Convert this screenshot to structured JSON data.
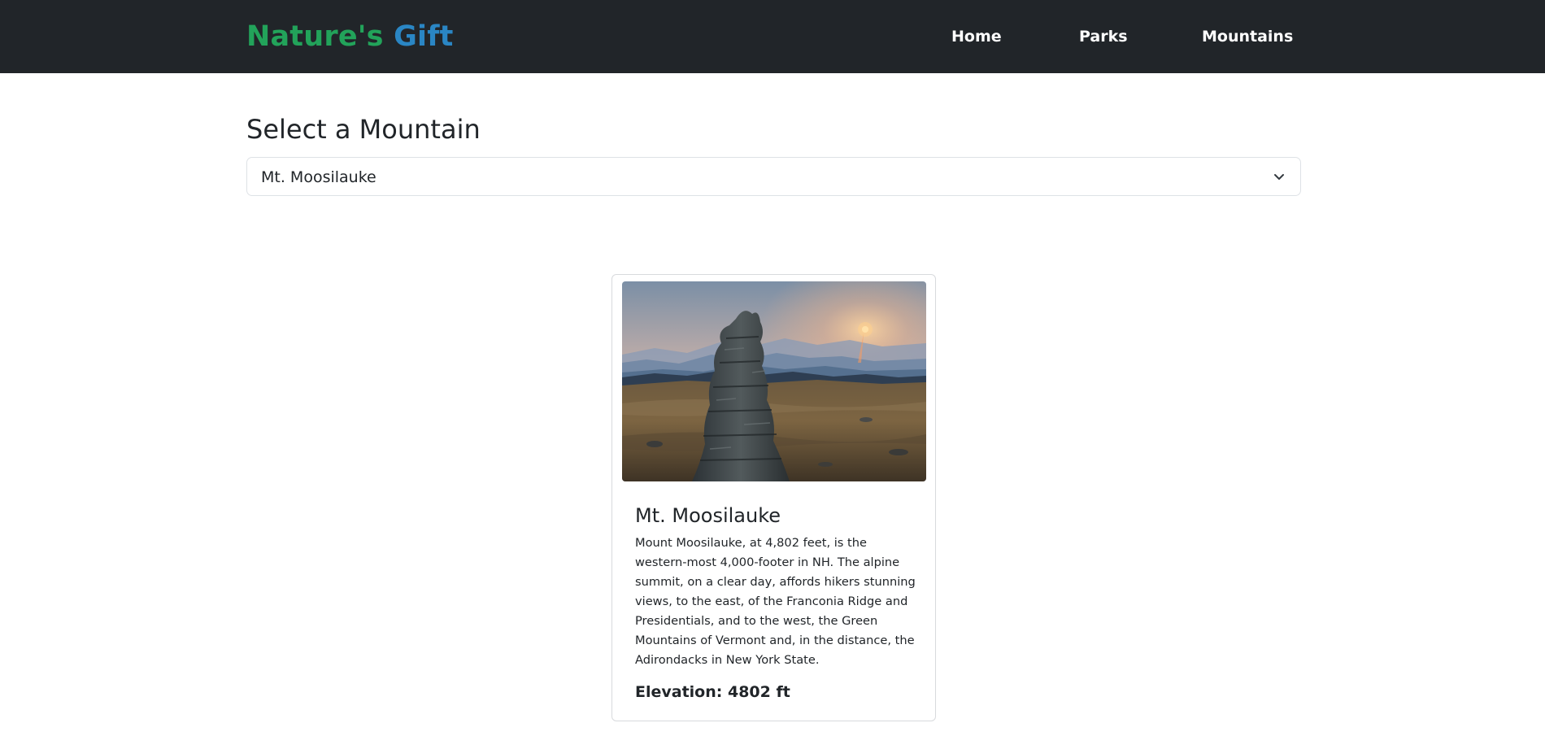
{
  "navbar": {
    "brand_part1": "Nature's",
    "brand_part2": "Gift",
    "links": [
      {
        "label": "Home"
      },
      {
        "label": "Parks"
      },
      {
        "label": "Mountains"
      }
    ]
  },
  "main": {
    "heading": "Select a Mountain",
    "select": {
      "selected_value": "Mt. Moosilauke"
    }
  },
  "card": {
    "image_alt": "Mt. Moosilauke",
    "title": "Mt. Moosilauke",
    "description": "Mount Moosilauke, at 4,802 feet, is the western-most 4,000-footer in NH. The alpine summit, on a clear day, affords hikers stunning views, to the east, of the Franconia Ridge and Presidentials, and to the west, the Green Mountains of Vermont and, in the distance, the Adirondacks in New York State.",
    "elevation_text": "Elevation: 4802 ft"
  },
  "colors": {
    "navbar_bg": "#212529",
    "brand_green": "#22a35a",
    "brand_blue": "#2a86c4"
  },
  "icons": {
    "select_chevron": "chevron-down-icon"
  }
}
